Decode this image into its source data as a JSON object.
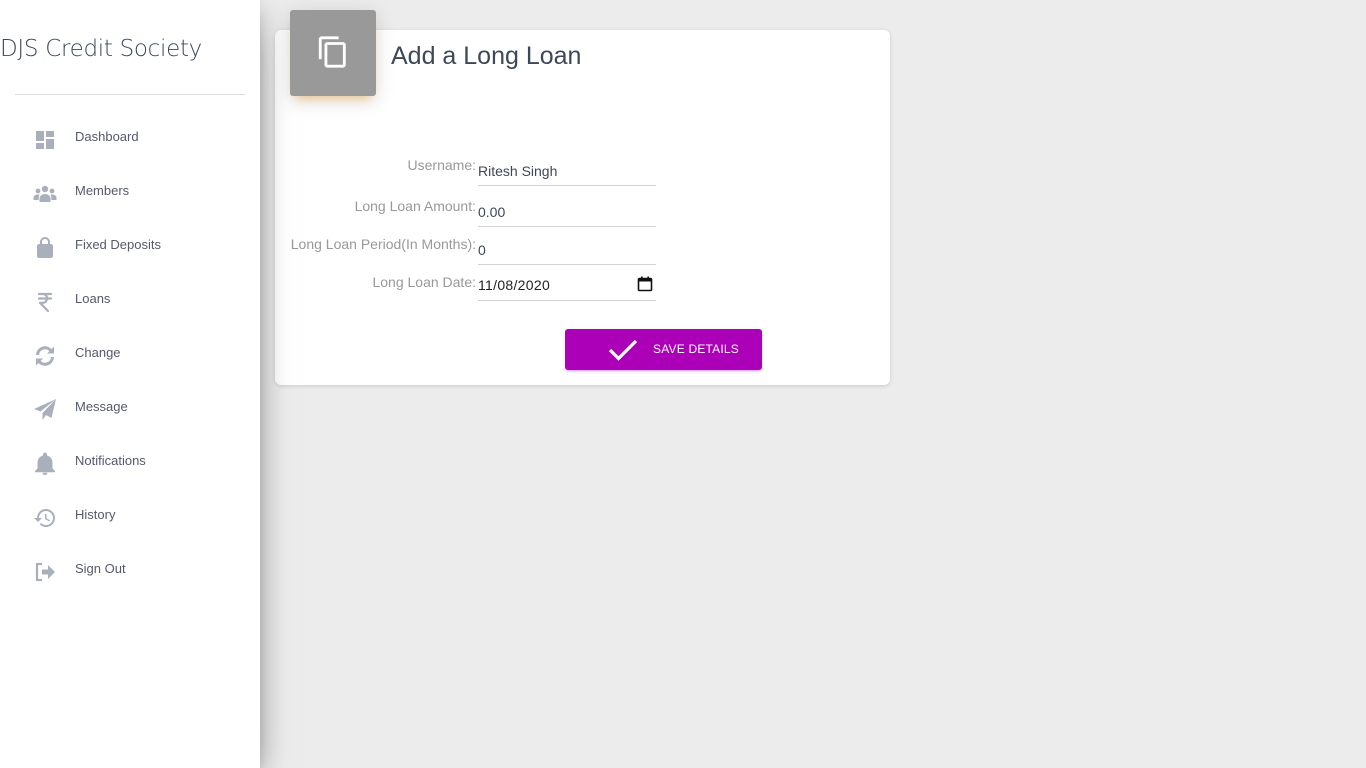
{
  "brand": {
    "title": "DJS Credit Society"
  },
  "sidebar": {
    "items": [
      {
        "label": "Dashboard",
        "icon": "dashboard-icon"
      },
      {
        "label": "Members",
        "icon": "members-icon"
      },
      {
        "label": "Fixed Deposits",
        "icon": "lock-icon"
      },
      {
        "label": "Loans",
        "icon": "rupee-icon"
      },
      {
        "label": "Change",
        "icon": "refresh-icon"
      },
      {
        "label": "Message",
        "icon": "paper-plane-icon"
      },
      {
        "label": "Notifications",
        "icon": "bell-icon"
      },
      {
        "label": "History",
        "icon": "history-icon"
      },
      {
        "label": "Sign Out",
        "icon": "sign-out-icon"
      }
    ]
  },
  "card": {
    "title": "Add a Long Loan",
    "header_icon": "copy-icon",
    "fields": {
      "username": {
        "label": "Username:",
        "value": "Ritesh Singh"
      },
      "amount": {
        "label": "Long Loan Amount:",
        "value": "0.00"
      },
      "period": {
        "label": "Long Loan Period(In Months):",
        "value": "0"
      },
      "date": {
        "label": "Long Loan Date:",
        "value": "11/08/2020"
      }
    },
    "save_button": {
      "label": "SAVE DETAILS",
      "icon": "check-icon"
    }
  },
  "colors": {
    "accent": "#ab00b8",
    "header_icon_bg": "#999999",
    "sidebar_icon": "#a9afbb",
    "background": "#ececec"
  }
}
